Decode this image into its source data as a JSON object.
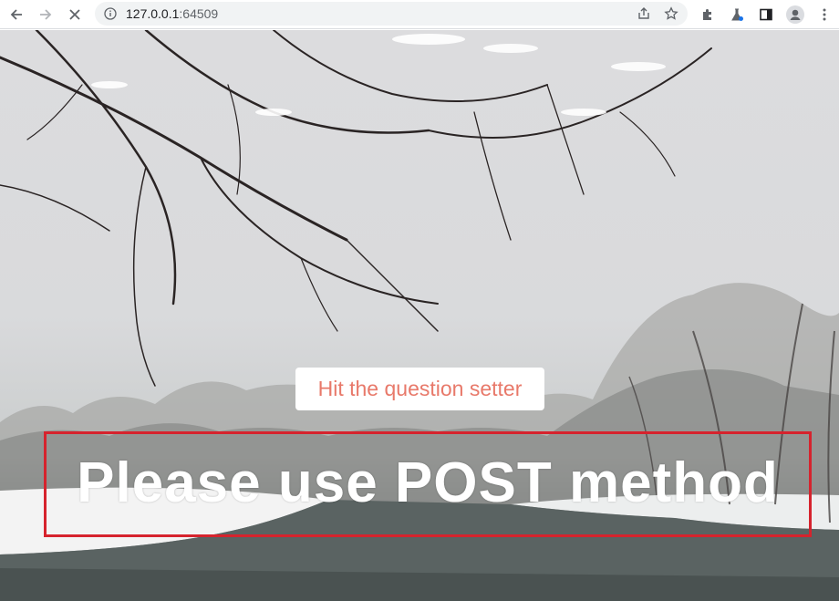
{
  "browser": {
    "url_host": "127.0.0.1",
    "url_port": ":64509"
  },
  "page": {
    "button_label": "Hit the question setter",
    "message": "Please use POST method"
  },
  "colors": {
    "button_text": "#e8796a",
    "box_border": "#d6232d",
    "message_text": "#ffffff"
  }
}
